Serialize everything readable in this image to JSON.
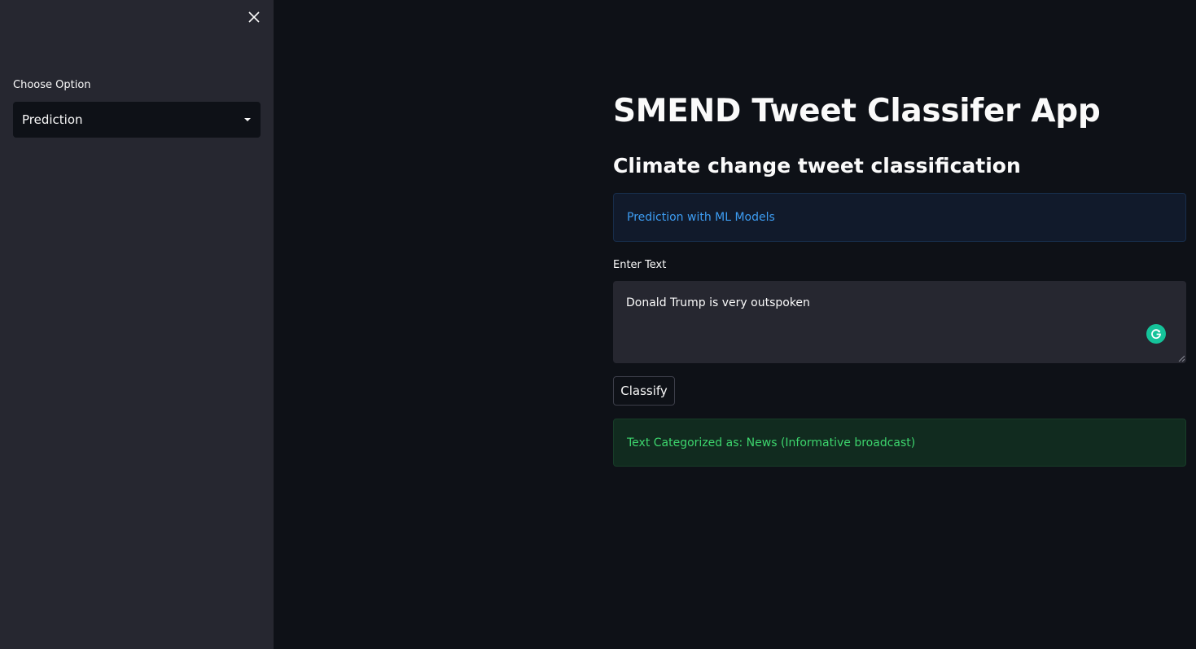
{
  "sidebar": {
    "close_icon": "close-icon",
    "label": "Choose Option",
    "select": {
      "selected": "Prediction",
      "caret_icon": "caret-down-icon"
    }
  },
  "main": {
    "title": "SMEND Tweet Classifer App",
    "subtitle": "Climate change tweet classification",
    "info_message": "Prediction with ML Models",
    "input_label": "Enter Text",
    "input_value": "Donald Trump is very outspoken",
    "grammarly_icon": "grammarly-icon",
    "classify_label": "Classify",
    "result_message": "Text Categorized as: News (Informative broadcast)"
  },
  "colors": {
    "app_bg": "#0e1117",
    "sidebar_bg": "#262730",
    "info_text": "#3d9df3",
    "success_text": "#3dd56d",
    "grammarly": "#15c39a"
  }
}
